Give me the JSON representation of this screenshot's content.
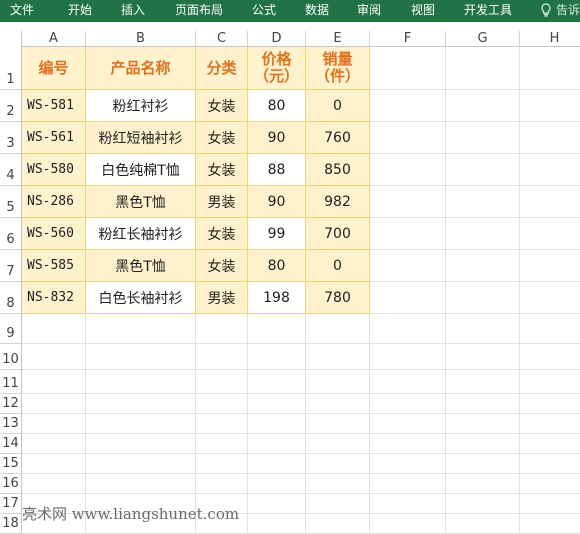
{
  "ribbon": {
    "tabs": [
      "文件",
      "开始",
      "插入",
      "页面布局",
      "公式",
      "数据",
      "审阅",
      "视图",
      "开发工具"
    ],
    "tell_me": "告诉"
  },
  "columns": [
    "A",
    "B",
    "C",
    "D",
    "E",
    "F",
    "G",
    "H"
  ],
  "rows": [
    "1",
    "2",
    "3",
    "4",
    "5",
    "6",
    "7",
    "8",
    "9",
    "10",
    "11",
    "12",
    "13",
    "14",
    "15",
    "16",
    "17",
    "18"
  ],
  "table": {
    "headers": [
      "编号",
      "产品名称",
      "分类",
      "价格\n（元）",
      "销量\n（件）"
    ],
    "rows": [
      [
        "WS-581",
        "粉红衬衫",
        "女装",
        "80",
        "0"
      ],
      [
        "WS-561",
        "粉红短袖衬衫",
        "女装",
        "90",
        "760"
      ],
      [
        "WS-580",
        "白色纯棉T恤",
        "女装",
        "88",
        "850"
      ],
      [
        "NS-286",
        "黑色T恤",
        "男装",
        "90",
        "982"
      ],
      [
        "WS-560",
        "粉红长袖衬衫",
        "女装",
        "99",
        "700"
      ],
      [
        "WS-585",
        "黑色T恤",
        "女装",
        "80",
        "0"
      ],
      [
        "NS-832",
        "白色长袖衬衫",
        "男装",
        "198",
        "780"
      ]
    ]
  },
  "watermark": "亮术网 www.liangshunet.com",
  "colors": {
    "ribbon": "#217346",
    "header_text": "#e2731e",
    "highlight": "#fff2cc"
  }
}
